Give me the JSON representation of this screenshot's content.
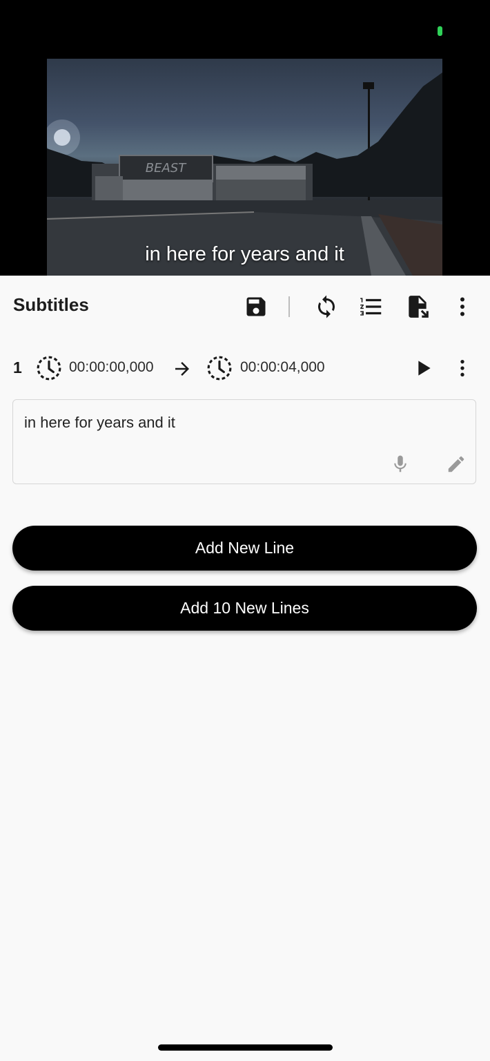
{
  "video": {
    "subtitle_overlay": "in here for years and it",
    "sign_text": "BEAST"
  },
  "header": {
    "title": "Subtitles",
    "icons": [
      "save-icon",
      "sync-icon",
      "numbered-list-icon",
      "file-export-icon",
      "more-vert-icon"
    ]
  },
  "subtitle_line": {
    "index": "1",
    "start_time": "00:00:00,000",
    "end_time": "00:00:04,000",
    "text": "in here for years and it"
  },
  "buttons": {
    "add_line": "Add New Line",
    "add_ten_lines": "Add 10 New Lines"
  },
  "colors": {
    "status_dot": "#2fd158",
    "button_bg": "#000000",
    "page_bg": "#f9f9f9"
  }
}
